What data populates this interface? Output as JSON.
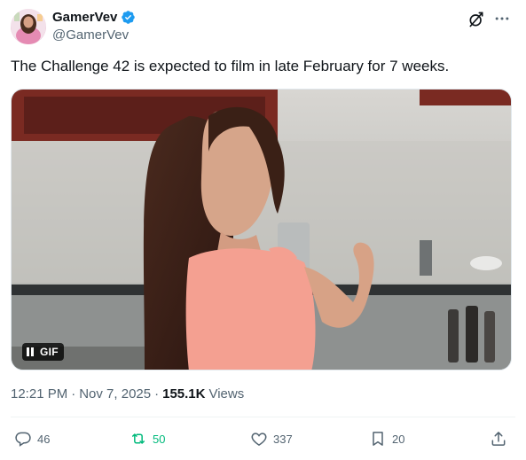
{
  "author": {
    "display_name": "GamerVev",
    "handle": "@GamerVev",
    "verified": true
  },
  "tweet": {
    "text": "The Challenge 42 is expected to film in late February for 7 weeks.",
    "media_badge": "GIF"
  },
  "meta": {
    "time": "12:21 PM",
    "separator1": "·",
    "date": "Nov 7, 2025",
    "separator2": "·",
    "views_count": "155.1K",
    "views_label": "Views"
  },
  "actions": {
    "replies": "46",
    "reposts": "50",
    "likes": "337",
    "bookmarks": "20"
  },
  "colors": {
    "text_primary": "#0f1419",
    "text_secondary": "#536471",
    "verified_blue": "#1d9bf0",
    "repost_green": "#00ba7c"
  },
  "icons": [
    "verified-badge-icon",
    "grok-icon",
    "more-icon",
    "pause-icon",
    "reply-icon",
    "repost-icon",
    "like-icon",
    "bookmark-icon",
    "share-icon"
  ]
}
